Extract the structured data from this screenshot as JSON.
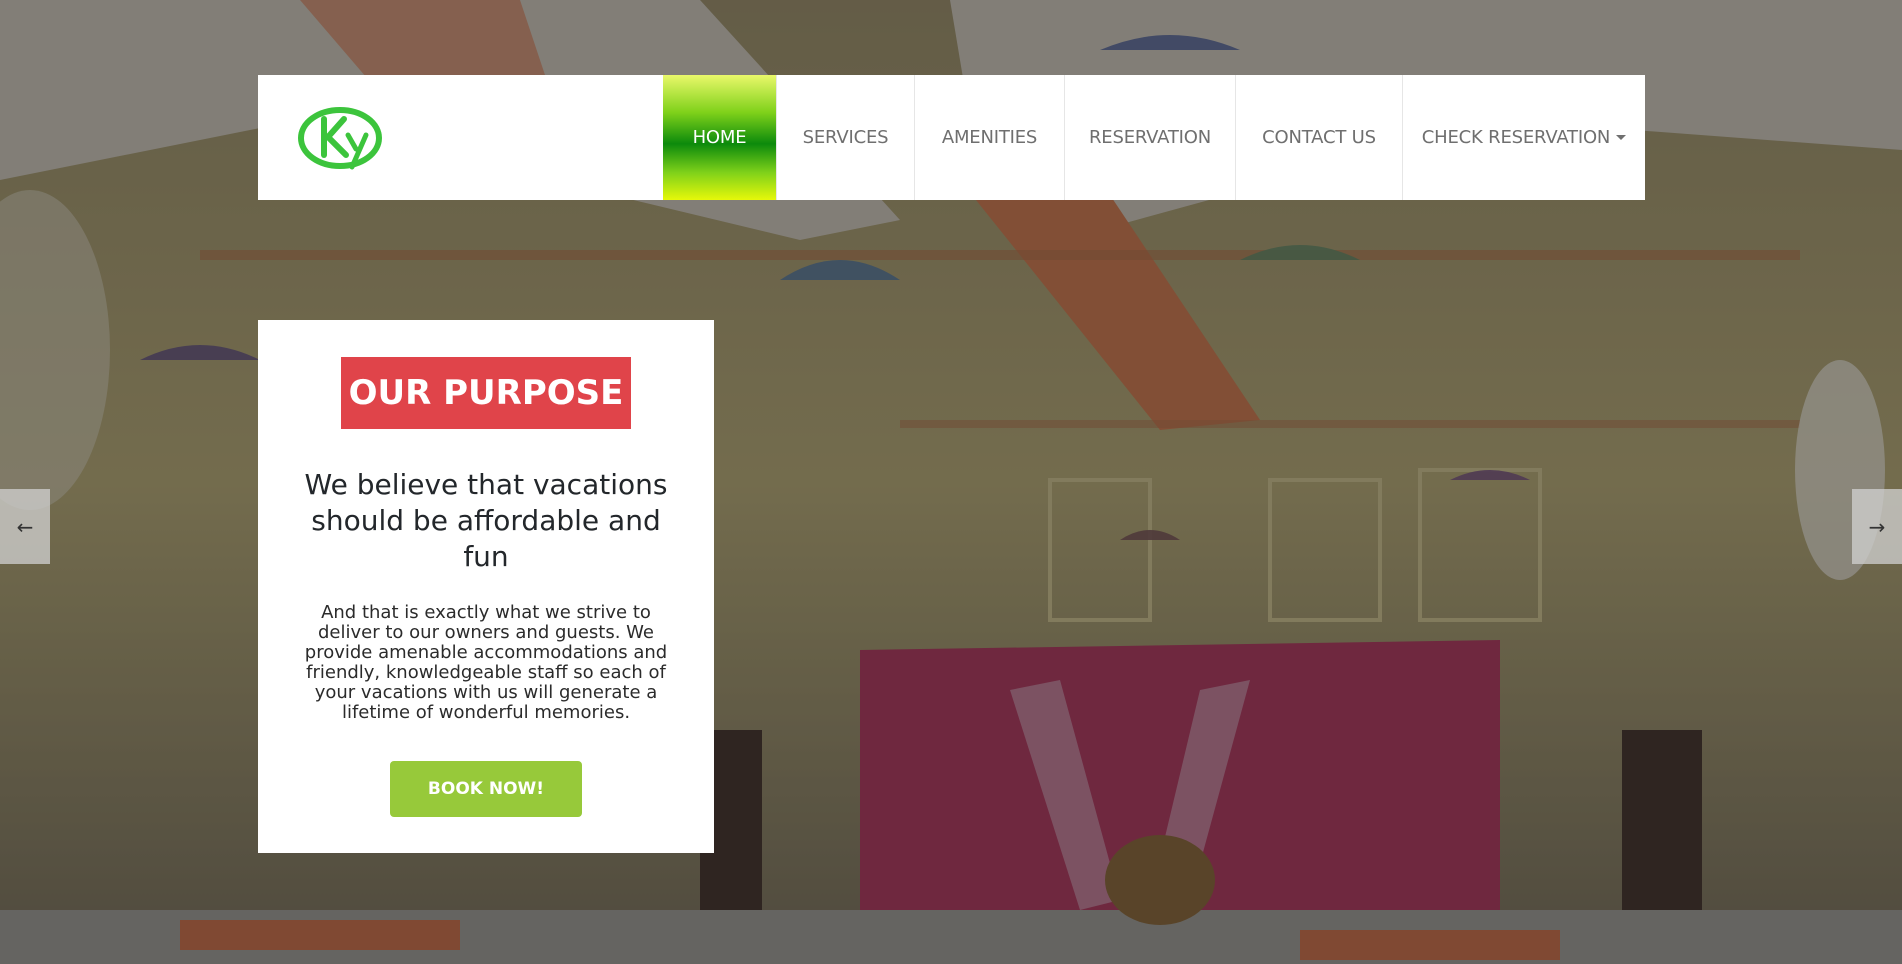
{
  "nav": {
    "items": [
      {
        "label": "HOME",
        "active": true
      },
      {
        "label": "SERVICES"
      },
      {
        "label": "AMENITIES"
      },
      {
        "label": "RESERVATION"
      },
      {
        "label": "CONTACT US"
      },
      {
        "label": "CHECK RESERVATION",
        "dropdown": true
      }
    ]
  },
  "logo": {
    "icon": "ky-logo-icon",
    "color": "#3cc43c"
  },
  "purpose": {
    "badge": "OUR PURPOSE",
    "heading": "We believe that vacations should be affordable and fun",
    "body": "And that is exactly what we strive to deliver to our owners and guests. We provide amenable accommodations and friendly, knowledgeable staff so each of your vacations with us will generate a lifetime of wonderful memories.",
    "button": "BOOK NOW!"
  },
  "carousel": {
    "prev": "←",
    "next": "→"
  },
  "colors": {
    "badge": "#e0444a",
    "button": "#97c93a",
    "active_nav": "#0c8a0c"
  }
}
